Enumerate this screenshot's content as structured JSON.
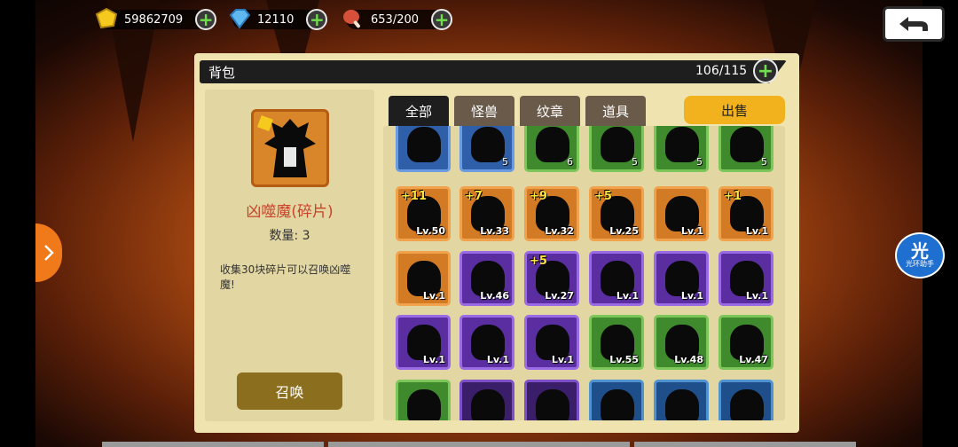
{
  "resources": {
    "gold": "59862709",
    "gems": "12110",
    "stamina": "653/200"
  },
  "panel": {
    "title": "背包",
    "capacity": "106/115"
  },
  "detail": {
    "name": "凶噬魔(碎片)",
    "qty_label": "数量:",
    "qty_value": "3",
    "description": "收集30块碎片可以召唤凶噬魔!",
    "summon_label": "召唤"
  },
  "tabs": [
    "全部",
    "怪兽",
    "纹章",
    "道具"
  ],
  "sell_label": "出售",
  "helper": {
    "big": "光",
    "small": "光环助手"
  },
  "items": [
    {
      "color": "blue",
      "count": ""
    },
    {
      "color": "blue",
      "count": "5"
    },
    {
      "color": "green",
      "count": "6"
    },
    {
      "color": "green",
      "count": "5"
    },
    {
      "color": "green",
      "count": "5"
    },
    {
      "color": "green",
      "count": "5"
    },
    {
      "color": "orange",
      "plus": "+11",
      "lv": "Lv.50"
    },
    {
      "color": "orange",
      "plus": "+7",
      "lv": "Lv.33"
    },
    {
      "color": "orange",
      "plus": "+9",
      "lv": "Lv.32"
    },
    {
      "color": "orange",
      "plus": "+5",
      "lv": "Lv.25"
    },
    {
      "color": "orange",
      "plus": "",
      "lv": "Lv.1"
    },
    {
      "color": "orange",
      "plus": "+1",
      "lv": "Lv.1"
    },
    {
      "color": "orange",
      "plus": "",
      "lv": "Lv.1"
    },
    {
      "color": "purple",
      "plus": "",
      "lv": "Lv.46"
    },
    {
      "color": "purple",
      "plus": "+5",
      "lv": "Lv.27"
    },
    {
      "color": "purple",
      "plus": "",
      "lv": "Lv.1"
    },
    {
      "color": "purple",
      "plus": "",
      "lv": "Lv.1"
    },
    {
      "color": "purple",
      "plus": "",
      "lv": "Lv.1"
    },
    {
      "color": "purple",
      "plus": "",
      "lv": "Lv.1"
    },
    {
      "color": "purple",
      "plus": "",
      "lv": "Lv.1"
    },
    {
      "color": "purple",
      "plus": "",
      "lv": "Lv.1"
    },
    {
      "color": "green",
      "plus": "",
      "lv": "Lv.55"
    },
    {
      "color": "green",
      "plus": "",
      "lv": "Lv.48"
    },
    {
      "color": "green",
      "plus": "",
      "lv": "Lv.47"
    },
    {
      "color": "green",
      "plus": "",
      "lv": ""
    },
    {
      "color": "dpurple",
      "plus": "",
      "lv": ""
    },
    {
      "color": "dpurple",
      "plus": "",
      "lv": ""
    },
    {
      "color": "teal",
      "plus": "",
      "lv": ""
    },
    {
      "color": "teal",
      "plus": "",
      "lv": ""
    },
    {
      "color": "teal",
      "plus": "",
      "lv": ""
    }
  ]
}
